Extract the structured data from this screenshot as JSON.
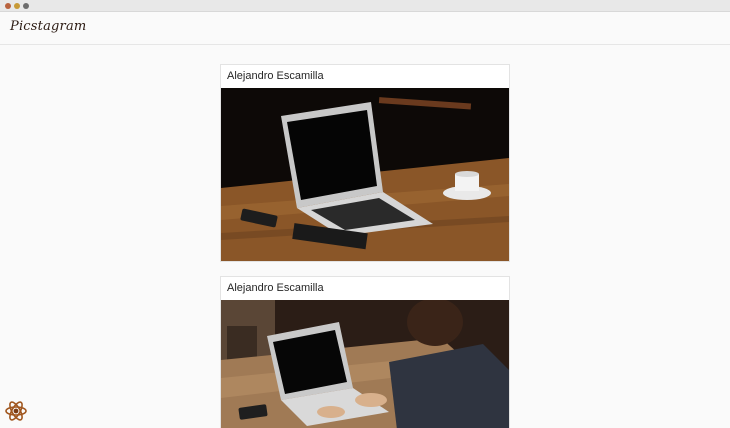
{
  "app": {
    "name": "Picstagram"
  },
  "feed": {
    "posts": [
      {
        "author": "Alejandro Escamilla",
        "photo": "laptop-on-wooden-table"
      },
      {
        "author": "Alejandro Escamilla",
        "photo": "person-typing-on-laptop"
      }
    ]
  },
  "colors": {
    "background": "#fafafa",
    "card": "#ffffff",
    "border": "#e3e3e3",
    "text": "#262626",
    "logo": "#2b1a12"
  },
  "icons": {
    "corner": "atom-icon"
  }
}
